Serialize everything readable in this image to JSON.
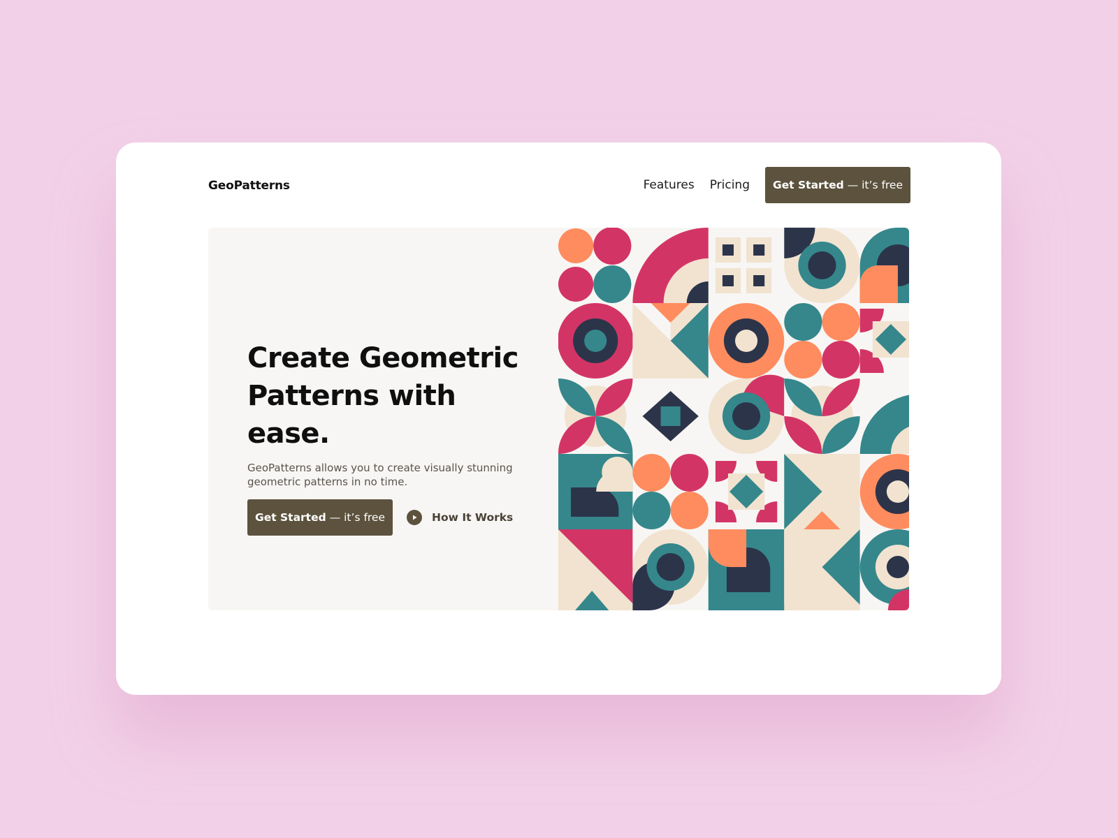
{
  "header": {
    "logo": "GeoPatterns",
    "nav": [
      "Features",
      "Pricing"
    ],
    "cta_bold": "Get Started",
    "cta_light": "— it’s free"
  },
  "hero": {
    "headline_line1": "Create Geometric",
    "headline_line2": "Patterns with ease.",
    "subtitle": "GeoPatterns allows you to create visually stunning geometric patterns in no time.",
    "cta_bold": "Get Started",
    "cta_light": "— it’s free",
    "secondary_label": "How It Works"
  },
  "icons": {
    "play": "play-icon"
  },
  "colors": {
    "page_background": "#f2d1e8",
    "card": "#ffffff",
    "hero_panel": "#f7f6f4",
    "button": "#5c523d",
    "pattern_magenta": "#d33466",
    "pattern_orange": "#ff8c5e",
    "pattern_teal": "#35878b",
    "pattern_navy": "#2c344a",
    "pattern_cream": "#f1e3d0"
  }
}
